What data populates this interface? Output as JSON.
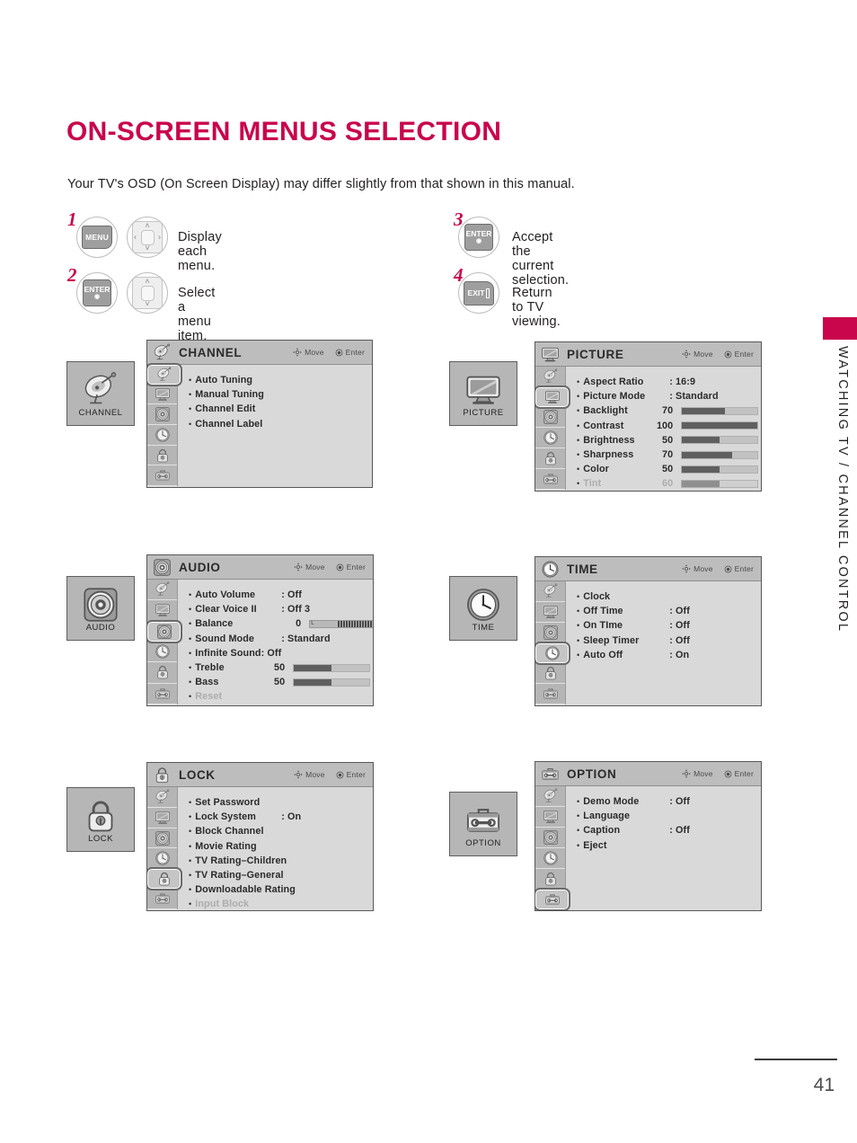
{
  "page": {
    "title": "ON-SCREEN MENUS SELECTION",
    "intro": "Your TV's OSD (On Screen Display) may differ slightly from that shown in this manual.",
    "side_tab_label": "WATCHING TV / CHANNEL CONTROL",
    "page_number": "41",
    "accent_color": "#c9054c"
  },
  "steps": [
    {
      "num": "1",
      "key1": "MENU",
      "key1_icon": "menu-button-icon",
      "key2_icon": "dpad-4way-icon",
      "text": "Display each menu."
    },
    {
      "num": "2",
      "key1": "ENTER",
      "key1_icon": "enter-button-icon",
      "key2_icon": "dpad-updown-icon",
      "text": "Select a menu item."
    },
    {
      "num": "3",
      "key1": "ENTER",
      "key1_icon": "enter-button-icon",
      "key2_icon": "",
      "text": "Accept the current selection."
    },
    {
      "num": "4",
      "key1": "EXIT",
      "key1_icon": "exit-button-icon",
      "key2_icon": "",
      "text": "Return to TV viewing."
    }
  ],
  "hints": {
    "move": "Move",
    "enter": "Enter"
  },
  "rail_icons": [
    "satellite-dish-icon",
    "tv-icon",
    "speaker-icon",
    "clock-icon",
    "lock-icon",
    "toolbox-icon"
  ],
  "menus": [
    {
      "id": "channel",
      "title": "CHANNEL",
      "icon": "satellite-dish-icon",
      "box_caption": "CHANNEL",
      "selected_rail": 0,
      "rows": [
        {
          "label": "Auto Tuning"
        },
        {
          "label": "Manual Tuning"
        },
        {
          "label": "Channel Edit"
        },
        {
          "label": "Channel Label"
        }
      ]
    },
    {
      "id": "picture",
      "title": "PICTURE",
      "icon": "tv-icon",
      "box_caption": "PICTURE",
      "selected_rail": 1,
      "rows": [
        {
          "label": "Aspect Ratio",
          "value": ": 16:9"
        },
        {
          "label": "Picture Mode",
          "value": ": Standard"
        },
        {
          "sub": "Backlight",
          "num": "70",
          "bar": 57
        },
        {
          "sub": "Contrast",
          "num": "100",
          "bar": 100
        },
        {
          "sub": "Brightness",
          "num": "50",
          "bar": 50
        },
        {
          "sub": "Sharpness",
          "num": "70",
          "bar": 66
        },
        {
          "sub": "Color",
          "num": "50",
          "bar": 50
        },
        {
          "sub": "Tint",
          "num": "60",
          "bar": 50,
          "dim": true
        }
      ]
    },
    {
      "id": "audio",
      "title": "AUDIO",
      "icon": "speaker-icon",
      "box_caption": "AUDIO",
      "selected_rail": 2,
      "rows": [
        {
          "label": "Auto Volume",
          "value": ": Off"
        },
        {
          "label": "Clear Voice II",
          "value": ": Off  3"
        },
        {
          "label": "Balance",
          "balance": "0"
        },
        {
          "label": "Sound Mode",
          "value": ": Standard"
        },
        {
          "sub": "Infinite Sound: Off"
        },
        {
          "sub": "Treble",
          "num": "50",
          "bar": 50
        },
        {
          "sub": "Bass",
          "num": "50",
          "bar": 50
        },
        {
          "sub": "Reset",
          "dim": true
        }
      ]
    },
    {
      "id": "time",
      "title": "TIME",
      "icon": "clock-icon",
      "box_caption": "TIME",
      "selected_rail": 3,
      "rows": [
        {
          "label": "Clock"
        },
        {
          "label": "Off Time",
          "value": ": Off"
        },
        {
          "label": "On TIme",
          "value": ": Off"
        },
        {
          "label": "Sleep Timer",
          "value": ": Off"
        },
        {
          "label": "Auto Off",
          "value": ": On"
        }
      ]
    },
    {
      "id": "lock",
      "title": "LOCK",
      "icon": "lock-icon",
      "box_caption": "LOCK",
      "selected_rail": 4,
      "rows": [
        {
          "label": "Set Password"
        },
        {
          "label": "Lock System",
          "value": ": On"
        },
        {
          "sub": "Block Channel"
        },
        {
          "sub": "Movie Rating"
        },
        {
          "sub": "TV Rating–Children"
        },
        {
          "sub": "TV Rating–General"
        },
        {
          "sub": "Downloadable Rating"
        },
        {
          "sub": "Input Block",
          "dim": true
        }
      ]
    },
    {
      "id": "option",
      "title": "OPTION",
      "icon": "toolbox-icon",
      "box_caption": "OPTION",
      "selected_rail": 5,
      "rows": [
        {
          "label": "Demo Mode",
          "value": ": Off"
        },
        {
          "label": "Language"
        },
        {
          "label": "Caption",
          "value": ": Off"
        },
        {
          "label": "Eject"
        }
      ]
    }
  ]
}
